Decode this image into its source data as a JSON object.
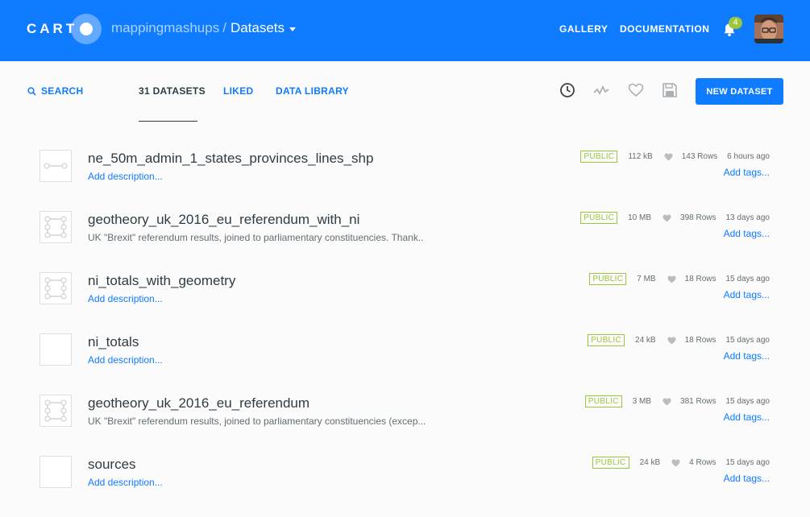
{
  "header": {
    "logo_text": "CART",
    "user": "mappingmashups",
    "separator": "/",
    "section": "Datasets",
    "links": [
      "GALLERY",
      "DOCUMENTATION"
    ],
    "notification_count": "4",
    "brand_color": "#0f7bff"
  },
  "toolbar": {
    "search_label": "SEARCH",
    "tabs": [
      {
        "label": "31 DATASETS",
        "active": true
      },
      {
        "label": "LIKED",
        "active": false
      },
      {
        "label": "DATA LIBRARY",
        "active": false
      }
    ],
    "icons": [
      "clock-icon",
      "activity-icon",
      "heart-icon",
      "save-icon"
    ],
    "new_button": "NEW DATASET"
  },
  "datasets": [
    {
      "name": "ne_50m_admin_1_states_provinces_lines_shp",
      "description": "Add description...",
      "has_description": false,
      "privacy": "PUBLIC",
      "size": "112 kB",
      "rows": "143 Rows",
      "updated": "6 hours ago",
      "tags": "Add tags...",
      "thumb": "line"
    },
    {
      "name": "geotheory_uk_2016_eu_referendum_with_ni",
      "description": "UK \"Brexit\" referendum results, joined to parliamentary constituencies. Thank..",
      "has_description": true,
      "privacy": "PUBLIC",
      "size": "10 MB",
      "rows": "398 Rows",
      "updated": "13 days ago",
      "tags": "Add tags...",
      "thumb": "polygon"
    },
    {
      "name": "ni_totals_with_geometry",
      "description": "Add description...",
      "has_description": false,
      "privacy": "PUBLIC",
      "size": "7 MB",
      "rows": "18 Rows",
      "updated": "15 days ago",
      "tags": "Add tags...",
      "thumb": "polygon"
    },
    {
      "name": "ni_totals",
      "description": "Add description...",
      "has_description": false,
      "privacy": "PUBLIC",
      "size": "24 kB",
      "rows": "18 Rows",
      "updated": "15 days ago",
      "tags": "Add tags...",
      "thumb": "empty"
    },
    {
      "name": "geotheory_uk_2016_eu_referendum",
      "description": "UK \"Brexit\" referendum results, joined to parliamentary constituencies (excep...",
      "has_description": true,
      "privacy": "PUBLIC",
      "size": "3 MB",
      "rows": "381 Rows",
      "updated": "15 days ago",
      "tags": "Add tags...",
      "thumb": "polygon"
    },
    {
      "name": "sources",
      "description": "Add description...",
      "has_description": false,
      "privacy": "PUBLIC",
      "size": "24 kB",
      "rows": "4 Rows",
      "updated": "15 days ago",
      "tags": "Add tags...",
      "thumb": "empty"
    }
  ]
}
